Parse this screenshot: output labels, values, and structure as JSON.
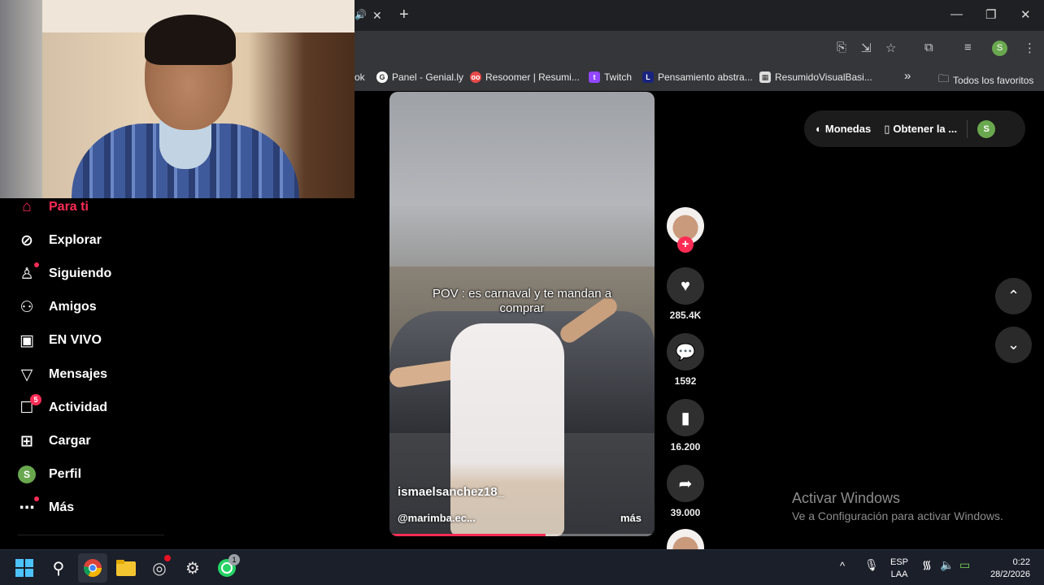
{
  "browser": {
    "bookmarks": [
      {
        "label": "ok"
      },
      {
        "label": "Panel - Genial.ly"
      },
      {
        "label": "Resoomer | Resumi..."
      },
      {
        "label": "Twitch"
      },
      {
        "label": "Pensamiento abstra..."
      },
      {
        "label": "ResumidoVisualBasi..."
      }
    ],
    "overflow_label": "»",
    "all_favorites": "Todos los favoritos",
    "profile_letter": "S"
  },
  "sidebar": {
    "items": [
      {
        "label": "Para ti",
        "icon": "home-icon"
      },
      {
        "label": "Explorar",
        "icon": "compass-icon"
      },
      {
        "label": "Siguiendo",
        "icon": "following-icon"
      },
      {
        "label": "Amigos",
        "icon": "friends-icon"
      },
      {
        "label": "EN VIVO",
        "icon": "live-icon"
      },
      {
        "label": "Mensajes",
        "icon": "messages-icon"
      },
      {
        "label": "Actividad",
        "icon": "activity-icon",
        "badge": "5"
      },
      {
        "label": "Cargar",
        "icon": "upload-icon"
      },
      {
        "label": "Perfil",
        "icon": "profile-icon"
      },
      {
        "label": "Más",
        "icon": "more-icon"
      }
    ],
    "profile_letter": "S"
  },
  "video": {
    "caption": "POV : es carnaval y te mandan a comprar",
    "username": "ismaelsanchez18_",
    "sound": "@marimba.ec...",
    "more_label": "más",
    "progress": 0.59
  },
  "actions": {
    "likes": "285.4K",
    "comments": "1592",
    "saves": "16.200",
    "shares": "39.000",
    "follow_symbol": "+"
  },
  "top_bar": {
    "coins": "Monedas",
    "get_app": "Obtener la ...",
    "profile_letter": "S"
  },
  "watermark": {
    "title": "Activar Windows",
    "subtitle": "Ve a Configuración para activar Windows."
  },
  "taskbar": {
    "lang_top": "ESP",
    "lang_bottom": "LAA",
    "time": "0:22",
    "date": "28/2/2026",
    "whatsapp_badge": "1"
  }
}
